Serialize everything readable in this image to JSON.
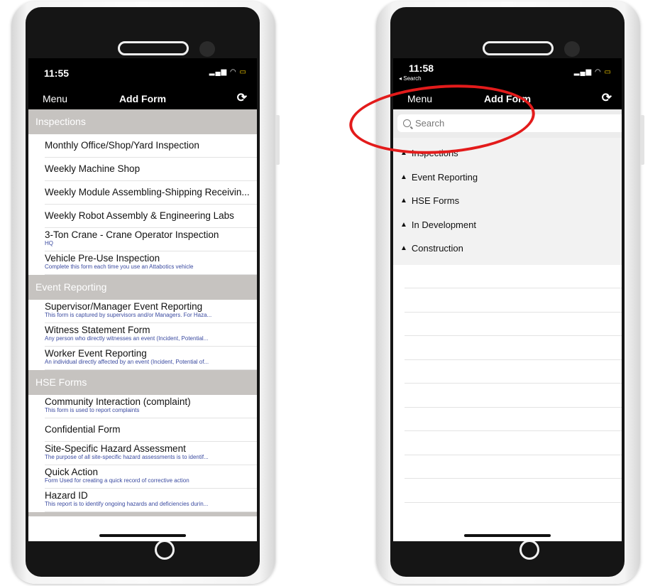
{
  "left_phone": {
    "status": {
      "time": "11:55"
    },
    "nav": {
      "menu": "Menu",
      "title": "Add Form"
    },
    "sections": [
      {
        "header": "Inspections",
        "items": [
          {
            "title": "Monthly Office/Shop/Yard Inspection",
            "subtitle": ""
          },
          {
            "title": "Weekly Machine Shop",
            "subtitle": ""
          },
          {
            "title": "Weekly Module Assembling-Shipping Receivin...",
            "subtitle": ""
          },
          {
            "title": "Weekly Robot Assembly & Engineering Labs",
            "subtitle": ""
          },
          {
            "title": "3-Ton Crane - Crane Operator Inspection",
            "subtitle": "HQ"
          },
          {
            "title": "Vehicle Pre-Use Inspection",
            "subtitle": "Complete this form each time you use an Attabotics vehicle"
          }
        ]
      },
      {
        "header": "Event Reporting",
        "items": [
          {
            "title": "Supervisor/Manager Event Reporting",
            "subtitle": "This form is captured by supervisors and/or Managers. For Haza..."
          },
          {
            "title": "Witness Statement Form",
            "subtitle": "Any person who directly witnesses an event (Incident, Potential..."
          },
          {
            "title": "Worker Event Reporting",
            "subtitle": "An individual directly affected by an event (Incident, Potential of..."
          }
        ]
      },
      {
        "header": "HSE Forms",
        "items": [
          {
            "title": "Community Interaction (complaint)",
            "subtitle": "This form is used to report complaints"
          },
          {
            "title": "Confidential Form",
            "subtitle": ""
          },
          {
            "title": "Site-Specific Hazard Assessment",
            "subtitle": "The purpose of all site-specific hazard assessments is to identif..."
          },
          {
            "title": "Quick Action",
            "subtitle": "Form Used for creating a quick record of corrective action"
          },
          {
            "title": "Hazard ID",
            "subtitle": "This report is to identify ongoing hazards and deficiencies durin..."
          }
        ]
      }
    ]
  },
  "right_phone": {
    "status": {
      "time": "11:58",
      "back": "◂ Search"
    },
    "nav": {
      "menu": "Menu",
      "title": "Add Form"
    },
    "search": {
      "placeholder": "Search"
    },
    "categories": [
      {
        "label": "Inspections"
      },
      {
        "label": "Event Reporting"
      },
      {
        "label": "HSE Forms"
      },
      {
        "label": "In Development"
      },
      {
        "label": "Construction"
      }
    ],
    "empty_rows": 10
  },
  "icons": {
    "refresh": "refresh-icon",
    "search": "search-icon",
    "collapse": "triangle-up-icon",
    "signal": "signal-icon",
    "wifi": "wifi-icon",
    "battery": "battery-charging-icon"
  },
  "colors": {
    "section_header_bg": "#c6c3c0",
    "subtitle_text": "#3a4aa0",
    "annotation": "#e31b1b"
  }
}
